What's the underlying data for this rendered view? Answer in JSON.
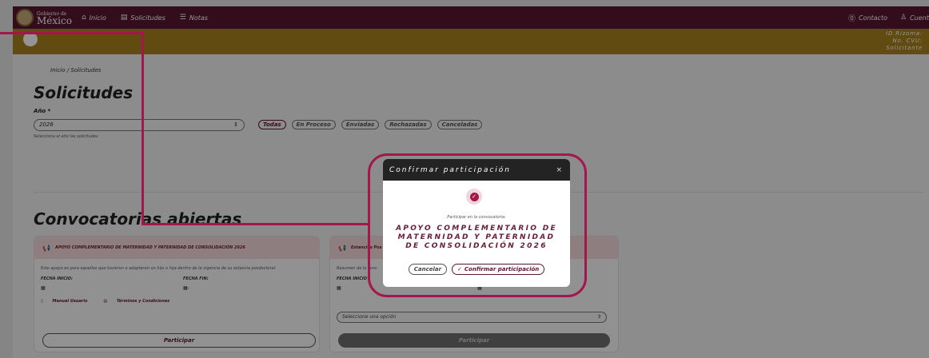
{
  "navbar": {
    "logo_line1": "Gobierno de",
    "logo_line2": "México",
    "links": [
      {
        "icon": "home-icon",
        "glyph": "⌂",
        "label": "Inicio"
      },
      {
        "icon": "document-icon",
        "glyph": "▤",
        "label": "Solicitudes"
      },
      {
        "icon": "list-icon",
        "glyph": "☰",
        "label": "Notas"
      }
    ],
    "right": [
      {
        "icon": "help-icon",
        "glyph": "⓪",
        "label": "Contacto"
      },
      {
        "icon": "user-icon",
        "glyph": "♙",
        "label": "Cuenta"
      }
    ]
  },
  "userbar": {
    "id_label": "ID Rizoma:",
    "cvu_label": "No. CVU:",
    "role": "Solicitante"
  },
  "breadcrumb": "Inicio / Solicitudes",
  "page_title": "Solicitudes",
  "year": {
    "label": "Año *",
    "value": "2026",
    "help": "Selecciona el año las solicitudes"
  },
  "filters": [
    "Todas",
    "En Proceso",
    "Enviadas",
    "Rechazadas",
    "Canceladas"
  ],
  "section_title": "Convocatorias abiertas",
  "cards": [
    {
      "title": "APOYO COMPLEMENTARIO DE MATERNIDAD Y PATERNIDAD DE CONSOLIDACIÓN 2026",
      "description": "Este apoyo es para aquellos que tuvieron o adoptaron un hijo o hija dentro de la vigencia de su estancia posdoctoral.",
      "start_label": "FECHA INICIO:",
      "end_label": "FECHA FIN:",
      "start_value": "▦",
      "end_value": "▦-",
      "manual": "Manual Usuario",
      "terms": "Términos y Condiciones",
      "button": "Participar"
    },
    {
      "title": "Estancias Pos",
      "description": "Resumen de la conv",
      "start_label": "FECHA INICIO",
      "start_value": "▦",
      "end_value": "▦",
      "select_placeholder": "Seleccione una opción",
      "button": "Participar"
    }
  ],
  "modal": {
    "title": "Confirmar participación",
    "close": "×",
    "subtitle": "Participar en la convocatoria:",
    "convocatoria": "APOYO COMPLEMENTARIO DE MATERNIDAD Y PATERNIDAD DE CONSOLIDACIÓN 2026",
    "cancel": "Cancelar",
    "confirm": "Confirmar participación",
    "confirm_glyph": "✓"
  },
  "colors": {
    "navbar": "#5b1833",
    "gold": "#a8811d",
    "accent": "#a3174a"
  }
}
